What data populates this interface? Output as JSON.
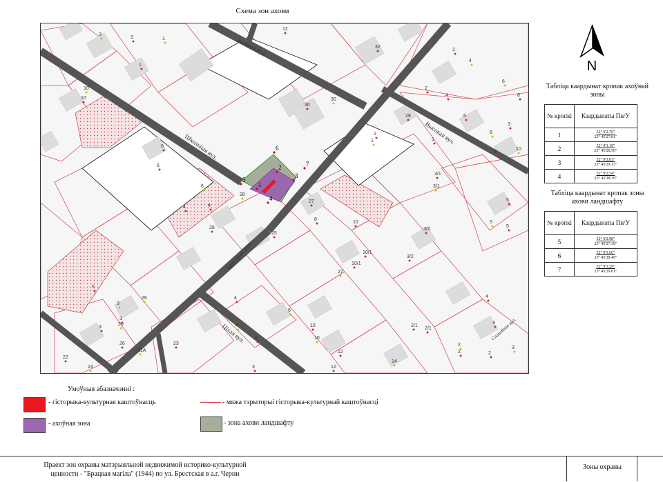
{
  "map": {
    "title": "Схема зон ахови",
    "streets": {
      "zialionaja": "Зялёная вул.",
      "shkolnaja": "Школьная вул.",
      "brestskaja": "Брэсцкая вул.",
      "tsikhaja": "Ціхая вул.",
      "vysokaja": "Высокая вул.",
      "spakojnaja": "Спакойная вул."
    },
    "zone_points": [
      "1",
      "2",
      "3",
      "4",
      "5",
      "6",
      "7"
    ],
    "house_numbers": [
      "3",
      "3",
      "1",
      "1",
      "12",
      "32",
      "10",
      "10",
      "30",
      "30",
      "29",
      "2",
      "4",
      "2",
      "4",
      "6",
      "6",
      "8",
      "8",
      "6",
      "6",
      "6",
      "4",
      "4",
      "28",
      "28",
      "27",
      "26",
      "25",
      "3/1",
      "3/1",
      "10",
      "8",
      "1",
      "1",
      "5",
      "5",
      "3/2",
      "3/2",
      "27",
      "10/1",
      "10/1",
      "6",
      "4",
      "5",
      "3",
      "3",
      "26",
      "26",
      "3",
      "2",
      "24",
      "23",
      "22",
      "21А",
      "3",
      "10",
      "10",
      "12",
      "12",
      "14",
      "2",
      "4",
      "4",
      "2/1",
      "2/1",
      "3",
      "5",
      "8",
      "2",
      "3",
      "1",
      "10",
      "4",
      "6"
    ],
    "north_label": "N"
  },
  "tables": {
    "protection": {
      "title": "Табліца каардынат кропак ахоўнай зоны",
      "header_no": "№ кропкі",
      "header_coords": "Каардынаты Пн/У",
      "rows": [
        {
          "no": "1",
          "lat": "52° 9'2.76\"",
          "lon": "23° 45'27.81\""
        },
        {
          "no": "2",
          "lat": "52° 9'3.19\"",
          "lon": "23° 45'28.50\""
        },
        {
          "no": "3",
          "lat": "52° 9'3.01\"",
          "lon": "23° 45'29.13\""
        },
        {
          "no": "4",
          "lat": "52° 9'2.54\"",
          "lon": "23° 45'28.39\""
        }
      ]
    },
    "landscape": {
      "title": "Табліца каардынат кропак зоны ахови ландшафту",
      "header_no": "№ кропкі",
      "header_coords": "Каардынаты Пн/У",
      "rows": [
        {
          "no": "5",
          "lat": "52° 9'2.98\"",
          "lon": "23° 45'27.38\""
        },
        {
          "no": "6",
          "lat": "52° 9'3.66\"",
          "lon": "23° 45'28.49\""
        },
        {
          "no": "7",
          "lat": "52° 9'3.29\"",
          "lon": "23° 45'29.61\""
        }
      ]
    }
  },
  "legend": {
    "title": "Умоўныя абазначэнні :",
    "items": [
      {
        "label": "- гісторыка-культурная каштоўнасць",
        "color": "#e8181e"
      },
      {
        "label": "- мяжа тэрыторыі гісторыка-культурнай каштоўнасці",
        "color": "#d9343f"
      },
      {
        "label": "- ахоўная зона",
        "color": "#9b67ae"
      },
      {
        "label": "- зона ахови ландшафту",
        "color": "#a6ae9b"
      }
    ]
  },
  "footer": {
    "project_line1": "Праект зон охраны матэрыяльной недвижимой историко-культурной",
    "project_line2": "ценности - \"Брацкая магіла\" (1944) по ул. Брестская в а.г. Черни",
    "sheet": "Зоны охраны"
  },
  "colors": {
    "road": "#555555",
    "parcel_border": "#d9535c",
    "building": "#dddddd",
    "hatched": "#f3dada",
    "protect_zone": "#9b67ae",
    "landscape_zone": "#a6ae9b",
    "monument": "#e8181e"
  }
}
